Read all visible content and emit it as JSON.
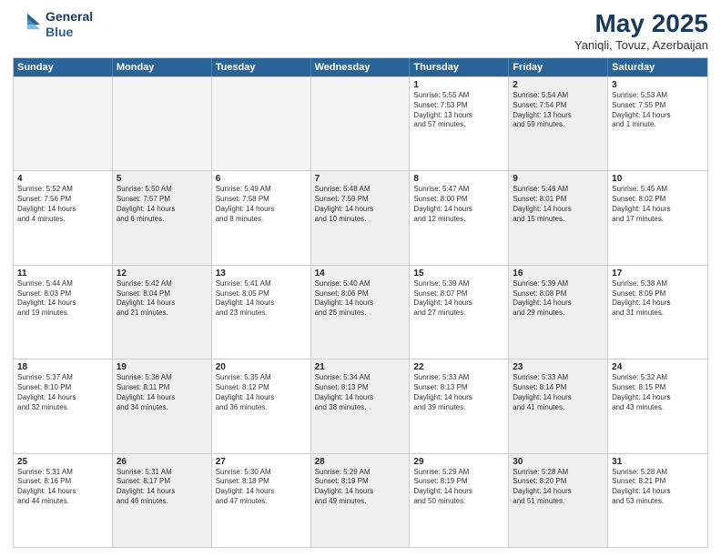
{
  "logo": {
    "line1": "General",
    "line2": "Blue"
  },
  "title": "May 2025",
  "subtitle": "Yaniqli, Tovuz, Azerbaijan",
  "header_days": [
    "Sunday",
    "Monday",
    "Tuesday",
    "Wednesday",
    "Thursday",
    "Friday",
    "Saturday"
  ],
  "rows": [
    [
      {
        "day": "",
        "text": "",
        "empty": true
      },
      {
        "day": "",
        "text": "",
        "empty": true
      },
      {
        "day": "",
        "text": "",
        "empty": true
      },
      {
        "day": "",
        "text": "",
        "empty": true
      },
      {
        "day": "1",
        "text": "Sunrise: 5:55 AM\nSunset: 7:53 PM\nDaylight: 13 hours\nand 57 minutes.",
        "shaded": false
      },
      {
        "day": "2",
        "text": "Sunrise: 5:54 AM\nSunset: 7:54 PM\nDaylight: 13 hours\nand 59 minutes.",
        "shaded": true
      },
      {
        "day": "3",
        "text": "Sunrise: 5:53 AM\nSunset: 7:55 PM\nDaylight: 14 hours\nand 1 minute.",
        "shaded": false
      }
    ],
    [
      {
        "day": "4",
        "text": "Sunrise: 5:52 AM\nSunset: 7:56 PM\nDaylight: 14 hours\nand 4 minutes.",
        "shaded": false
      },
      {
        "day": "5",
        "text": "Sunrise: 5:50 AM\nSunset: 7:57 PM\nDaylight: 14 hours\nand 6 minutes.",
        "shaded": true
      },
      {
        "day": "6",
        "text": "Sunrise: 5:49 AM\nSunset: 7:58 PM\nDaylight: 14 hours\nand 8 minutes.",
        "shaded": false
      },
      {
        "day": "7",
        "text": "Sunrise: 5:48 AM\nSunset: 7:59 PM\nDaylight: 14 hours\nand 10 minutes.",
        "shaded": true
      },
      {
        "day": "8",
        "text": "Sunrise: 5:47 AM\nSunset: 8:00 PM\nDaylight: 14 hours\nand 12 minutes.",
        "shaded": false
      },
      {
        "day": "9",
        "text": "Sunrise: 5:46 AM\nSunset: 8:01 PM\nDaylight: 14 hours\nand 15 minutes.",
        "shaded": true
      },
      {
        "day": "10",
        "text": "Sunrise: 5:45 AM\nSunset: 8:02 PM\nDaylight: 14 hours\nand 17 minutes.",
        "shaded": false
      }
    ],
    [
      {
        "day": "11",
        "text": "Sunrise: 5:44 AM\nSunset: 8:03 PM\nDaylight: 14 hours\nand 19 minutes.",
        "shaded": false
      },
      {
        "day": "12",
        "text": "Sunrise: 5:42 AM\nSunset: 8:04 PM\nDaylight: 14 hours\nand 21 minutes.",
        "shaded": true
      },
      {
        "day": "13",
        "text": "Sunrise: 5:41 AM\nSunset: 8:05 PM\nDaylight: 14 hours\nand 23 minutes.",
        "shaded": false
      },
      {
        "day": "14",
        "text": "Sunrise: 5:40 AM\nSunset: 8:06 PM\nDaylight: 14 hours\nand 25 minutes.",
        "shaded": true
      },
      {
        "day": "15",
        "text": "Sunrise: 5:39 AM\nSunset: 8:07 PM\nDaylight: 14 hours\nand 27 minutes.",
        "shaded": false
      },
      {
        "day": "16",
        "text": "Sunrise: 5:39 AM\nSunset: 8:08 PM\nDaylight: 14 hours\nand 29 minutes.",
        "shaded": true
      },
      {
        "day": "17",
        "text": "Sunrise: 5:38 AM\nSunset: 8:09 PM\nDaylight: 14 hours\nand 31 minutes.",
        "shaded": false
      }
    ],
    [
      {
        "day": "18",
        "text": "Sunrise: 5:37 AM\nSunset: 8:10 PM\nDaylight: 14 hours\nand 32 minutes.",
        "shaded": false
      },
      {
        "day": "19",
        "text": "Sunrise: 5:36 AM\nSunset: 8:11 PM\nDaylight: 14 hours\nand 34 minutes.",
        "shaded": true
      },
      {
        "day": "20",
        "text": "Sunrise: 5:35 AM\nSunset: 8:12 PM\nDaylight: 14 hours\nand 36 minutes.",
        "shaded": false
      },
      {
        "day": "21",
        "text": "Sunrise: 5:34 AM\nSunset: 8:13 PM\nDaylight: 14 hours\nand 38 minutes.",
        "shaded": true
      },
      {
        "day": "22",
        "text": "Sunrise: 5:33 AM\nSunset: 8:13 PM\nDaylight: 14 hours\nand 39 minutes.",
        "shaded": false
      },
      {
        "day": "23",
        "text": "Sunrise: 5:33 AM\nSunset: 8:14 PM\nDaylight: 14 hours\nand 41 minutes.",
        "shaded": true
      },
      {
        "day": "24",
        "text": "Sunrise: 5:32 AM\nSunset: 8:15 PM\nDaylight: 14 hours\nand 43 minutes.",
        "shaded": false
      }
    ],
    [
      {
        "day": "25",
        "text": "Sunrise: 5:31 AM\nSunset: 8:16 PM\nDaylight: 14 hours\nand 44 minutes.",
        "shaded": false
      },
      {
        "day": "26",
        "text": "Sunrise: 5:31 AM\nSunset: 8:17 PM\nDaylight: 14 hours\nand 46 minutes.",
        "shaded": true
      },
      {
        "day": "27",
        "text": "Sunrise: 5:30 AM\nSunset: 8:18 PM\nDaylight: 14 hours\nand 47 minutes.",
        "shaded": false
      },
      {
        "day": "28",
        "text": "Sunrise: 5:29 AM\nSunset: 8:19 PM\nDaylight: 14 hours\nand 49 minutes.",
        "shaded": true
      },
      {
        "day": "29",
        "text": "Sunrise: 5:29 AM\nSunset: 8:19 PM\nDaylight: 14 hours\nand 50 minutes.",
        "shaded": false
      },
      {
        "day": "30",
        "text": "Sunrise: 5:28 AM\nSunset: 8:20 PM\nDaylight: 14 hours\nand 51 minutes.",
        "shaded": true
      },
      {
        "day": "31",
        "text": "Sunrise: 5:28 AM\nSunset: 8:21 PM\nDaylight: 14 hours\nand 53 minutes.",
        "shaded": false
      }
    ]
  ]
}
